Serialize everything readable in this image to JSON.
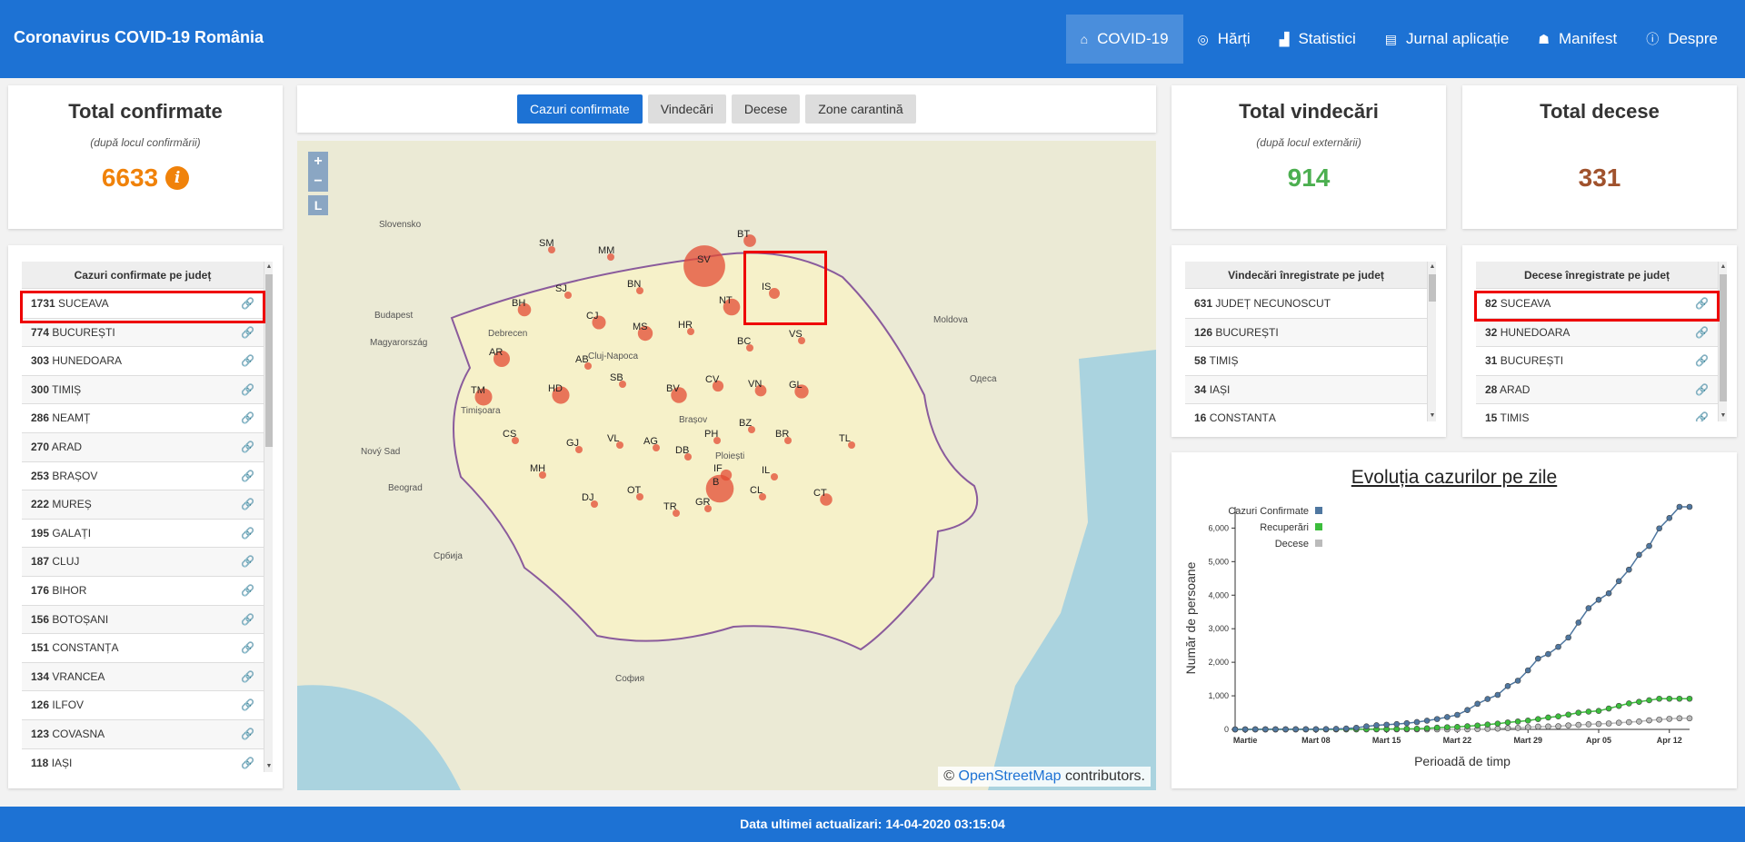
{
  "app": {
    "title": "Coronavirus COVID-19 România"
  },
  "nav": [
    {
      "label": "COVID-19",
      "icon": "home-icon",
      "glyph": "⌂",
      "active": true
    },
    {
      "label": "Hărți",
      "icon": "compass-icon",
      "glyph": "◎",
      "active": false
    },
    {
      "label": "Statistici",
      "icon": "chart-icon",
      "glyph": "▟",
      "active": false
    },
    {
      "label": "Jurnal aplicație",
      "icon": "document-icon",
      "glyph": "▤",
      "active": false
    },
    {
      "label": "Manifest",
      "icon": "users-icon",
      "glyph": "☗",
      "active": false
    },
    {
      "label": "Despre",
      "icon": "info-icon",
      "glyph": "ⓘ",
      "active": false
    }
  ],
  "confirmed": {
    "title": "Total confirmate",
    "subtitle": "(după locul confirmării)",
    "value": "6633",
    "color": "#f0820a"
  },
  "recovered": {
    "title": "Total vindecări",
    "subtitle": "(după locul externării)",
    "value": "914",
    "color": "#4caf50"
  },
  "deaths": {
    "title": "Total decese",
    "value": "331",
    "color": "#a0522d"
  },
  "tabs": [
    {
      "label": "Cazuri confirmate",
      "active": true
    },
    {
      "label": "Vindecări",
      "active": false
    },
    {
      "label": "Decese",
      "active": false
    },
    {
      "label": "Zone carantină",
      "active": false
    }
  ],
  "confirmed_list": {
    "header": "Cazuri confirmate pe județ",
    "rows": [
      {
        "count": "1731",
        "county": "SUCEAVA"
      },
      {
        "count": "774",
        "county": "BUCUREȘTI"
      },
      {
        "count": "303",
        "county": "HUNEDOARA"
      },
      {
        "count": "300",
        "county": "TIMIȘ"
      },
      {
        "count": "286",
        "county": "NEAMȚ"
      },
      {
        "count": "270",
        "county": "ARAD"
      },
      {
        "count": "253",
        "county": "BRAȘOV"
      },
      {
        "count": "222",
        "county": "MUREȘ"
      },
      {
        "count": "195",
        "county": "GALAȚI"
      },
      {
        "count": "187",
        "county": "CLUJ"
      },
      {
        "count": "176",
        "county": "BIHOR"
      },
      {
        "count": "156",
        "county": "BOTOȘANI"
      },
      {
        "count": "151",
        "county": "CONSTANȚA"
      },
      {
        "count": "134",
        "county": "VRANCEA"
      },
      {
        "count": "126",
        "county": "ILFOV"
      },
      {
        "count": "123",
        "county": "COVASNA"
      },
      {
        "count": "118",
        "county": "IAȘI"
      }
    ]
  },
  "recovered_list": {
    "header": "Vindecări înregistrate pe județ",
    "rows": [
      {
        "count": "631",
        "county": "JUDEȚ NECUNOSCUT"
      },
      {
        "count": "126",
        "county": "BUCUREȘTI"
      },
      {
        "count": "58",
        "county": "TIMIȘ"
      },
      {
        "count": "34",
        "county": "IAȘI"
      },
      {
        "count": "16",
        "county": "CONSTANȚA"
      }
    ]
  },
  "deaths_list": {
    "header": "Decese înregistrate pe județ",
    "rows": [
      {
        "count": "82",
        "county": "SUCEAVA"
      },
      {
        "count": "32",
        "county": "HUNEDOARA"
      },
      {
        "count": "31",
        "county": "BUCUREȘTI"
      },
      {
        "count": "28",
        "county": "ARAD"
      },
      {
        "count": "15",
        "county": "TIMIȘ"
      }
    ]
  },
  "map": {
    "zoom_in": "+",
    "zoom_out": "−",
    "layers": "L",
    "attribution_prefix": "©",
    "attribution_link": "OpenStreetMap",
    "attribution_suffix": "contributors.",
    "place_labels": [
      "Slovensko",
      "Magyarország",
      "Budapest",
      "Debrecen",
      "Cluj-Napoca",
      "Brașov",
      "Ploiești",
      "Moldova",
      "Одеса",
      "Србија",
      "София",
      "Nový Sad",
      "Beograd",
      "Timișoara"
    ],
    "counties": [
      {
        "code": "SV",
        "count": 1731
      },
      {
        "code": "BT",
        "count": 156
      },
      {
        "code": "MM",
        "count": 0
      },
      {
        "code": "SM",
        "count": 0
      },
      {
        "code": "BN",
        "count": 0
      },
      {
        "code": "IS",
        "count": 118
      },
      {
        "code": "SJ",
        "count": 0
      },
      {
        "code": "NT",
        "count": 286
      },
      {
        "code": "BH",
        "count": 176
      },
      {
        "code": "CJ",
        "count": 187
      },
      {
        "code": "HR",
        "count": 0
      },
      {
        "code": "VS",
        "count": 0
      },
      {
        "code": "MS",
        "count": 222
      },
      {
        "code": "BC",
        "count": 0
      },
      {
        "code": "AR",
        "count": 270
      },
      {
        "code": "AB",
        "count": 0
      },
      {
        "code": "SB",
        "count": 0
      },
      {
        "code": "CV",
        "count": 123
      },
      {
        "code": "VN",
        "count": 134
      },
      {
        "code": "GL",
        "count": 195
      },
      {
        "code": "TM",
        "count": 300
      },
      {
        "code": "HD",
        "count": 303
      },
      {
        "code": "BV",
        "count": 253
      },
      {
        "code": "BZ",
        "count": 0
      },
      {
        "code": "BR",
        "count": 0
      },
      {
        "code": "TL",
        "count": 0
      },
      {
        "code": "CS",
        "count": 0
      },
      {
        "code": "GJ",
        "count": 0
      },
      {
        "code": "VL",
        "count": 0
      },
      {
        "code": "AG",
        "count": 0
      },
      {
        "code": "DB",
        "count": 0
      },
      {
        "code": "PH",
        "count": 0
      },
      {
        "code": "IL",
        "count": 0
      },
      {
        "code": "MH",
        "count": 0
      },
      {
        "code": "DJ",
        "count": 0
      },
      {
        "code": "OT",
        "count": 0
      },
      {
        "code": "TR",
        "count": 0
      },
      {
        "code": "GR",
        "count": 0
      },
      {
        "code": "B",
        "count": 774
      },
      {
        "code": "IF",
        "count": 126
      },
      {
        "code": "CL",
        "count": 0
      },
      {
        "code": "CT",
        "count": 151
      }
    ]
  },
  "chart_data": {
    "type": "line",
    "title": "Evoluția cazurilor pe zile",
    "xlabel": "Perioadă de timp",
    "ylabel": "Număr de persoane",
    "x_ticks": [
      "Martie",
      "Mart 08",
      "Mart 15",
      "Mart 22",
      "Mart 29",
      "Apr 05",
      "Apr 12"
    ],
    "y_ticks": [
      "0",
      "1,000",
      "2,000",
      "3,000",
      "4,000",
      "5,000",
      "6,000"
    ],
    "ylim": [
      0,
      6633
    ],
    "legend_position": "top-left",
    "series": [
      {
        "name": "Cazuri Confirmate",
        "color": "#4f77a0",
        "values": [
          0,
          0,
          1,
          3,
          3,
          3,
          4,
          4,
          6,
          9,
          15,
          25,
          47,
          89,
          123,
          139,
          158,
          184,
          217,
          260,
          308,
          367,
          433,
          576,
          762,
          906,
          1029,
          1292,
          1452,
          1760,
          2109,
          2245,
          2460,
          2738,
          3183,
          3613,
          3864,
          4057,
          4417,
          4761,
          5202,
          5467,
          5990,
          6300,
          6633,
          6633
        ]
      },
      {
        "name": "Recuperări",
        "color": "#3cbd3c",
        "values": [
          0,
          0,
          0,
          0,
          0,
          0,
          0,
          0,
          0,
          0,
          1,
          3,
          3,
          3,
          6,
          9,
          12,
          17,
          19,
          31,
          52,
          64,
          73,
          94,
          115,
          143,
          171,
          206,
          234,
          262,
          307,
          354,
          387,
          440,
          497,
          529,
          550,
          622,
          700,
          774,
          822,
          868,
          914,
          914,
          914,
          914
        ]
      },
      {
        "name": "Decese",
        "color": "#bbbbbb",
        "values": [
          0,
          0,
          0,
          0,
          0,
          0,
          0,
          0,
          0,
          0,
          0,
          0,
          0,
          0,
          0,
          0,
          0,
          0,
          0,
          0,
          0,
          0,
          1,
          3,
          10,
          17,
          23,
          37,
          43,
          65,
          82,
          86,
          92,
          118,
          133,
          151,
          161,
          176,
          197,
          215,
          235,
          270,
          291,
          315,
          331,
          331
        ]
      }
    ]
  },
  "footer": {
    "text": "Data ultimei actualizari: 14-04-2020 03:15:04"
  }
}
